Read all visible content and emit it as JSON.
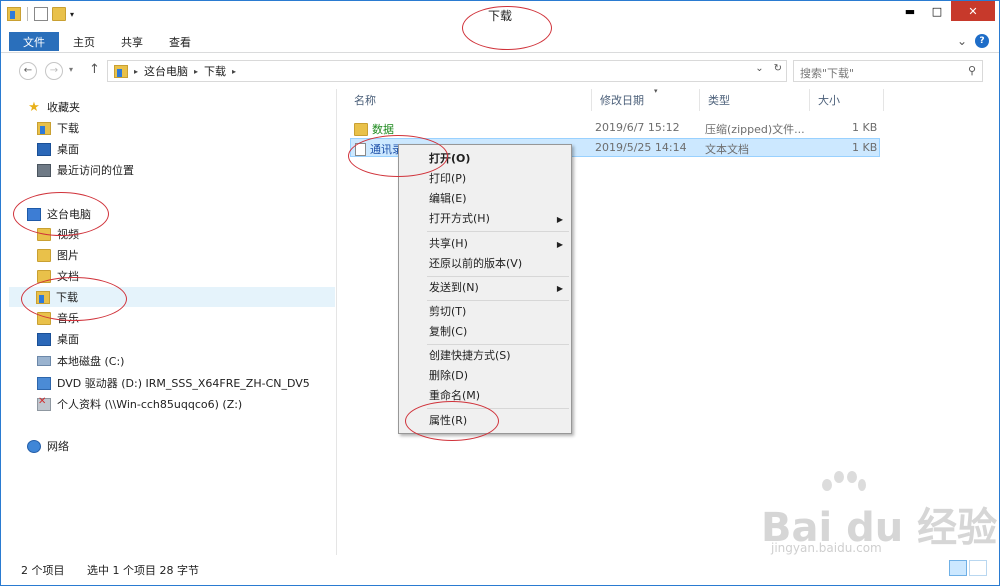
{
  "window": {
    "title": "下载"
  },
  "titlebar": {
    "minimize": "▬",
    "maximize": "□",
    "close": "✕"
  },
  "ribbon": {
    "tabs": [
      "文件",
      "主页",
      "共享",
      "查看"
    ],
    "expand": "⌄",
    "help": "?"
  },
  "address": {
    "crumbs": [
      "这台电脑",
      "下载"
    ],
    "dropdown": "⌄",
    "refresh": "↻"
  },
  "search": {
    "placeholder": "搜索\"下载\""
  },
  "sidebar": {
    "favorites": {
      "label": "收藏夹",
      "items": [
        "下载",
        "桌面",
        "最近访问的位置"
      ]
    },
    "this_pc": {
      "label": "这台电脑",
      "items": [
        "视频",
        "图片",
        "文档",
        "下载",
        "音乐",
        "桌面",
        "本地磁盘 (C:)",
        "DVD 驱动器 (D:) IRM_SSS_X64FRE_ZH-CN_DV5",
        "个人资料 (\\\\Win-cch85uqqco6) (Z:)"
      ]
    },
    "network": {
      "label": "网络"
    }
  },
  "columns": [
    "名称",
    "修改日期",
    "类型",
    "大小"
  ],
  "files": [
    {
      "name": "数据",
      "date": "2019/6/7 15:12",
      "type": "压缩(zipped)文件...",
      "size": "1 KB"
    },
    {
      "name": "通讯录",
      "date": "2019/5/25 14:14",
      "type": "文本文档",
      "size": "1 KB"
    }
  ],
  "context_menu": {
    "items": [
      "打开(O)",
      "打印(P)",
      "编辑(E)",
      "打开方式(H)",
      "共享(H)",
      "还原以前的版本(V)",
      "发送到(N)",
      "剪切(T)",
      "复制(C)",
      "创建快捷方式(S)",
      "删除(D)",
      "重命名(M)",
      "属性(R)"
    ]
  },
  "status": {
    "count": "2 个项目",
    "selection": "选中 1 个项目  28 字节"
  },
  "watermark": {
    "brand": "Bai du 经验",
    "url": "jingyan.baidu.com"
  }
}
